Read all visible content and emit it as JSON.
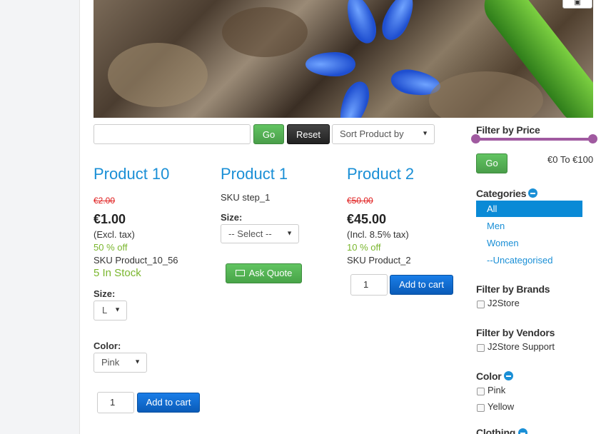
{
  "banner": {
    "corner_button_icon": "save-icon"
  },
  "search": {
    "go_label": "Go",
    "reset_label": "Reset",
    "sort_selected": "Sort Product by"
  },
  "products": [
    {
      "title": "Product 10",
      "old_price": "€2.00",
      "price": "€1.00",
      "tax_note": "(Excl. tax)",
      "discount": "50 % off",
      "sku": "SKU Product_10_56",
      "stock": "5 In Stock",
      "size_label": "Size:",
      "size_selected": "L",
      "color_label": "Color:",
      "color_selected": "Pink",
      "qty": "1",
      "cart_label": "Add to cart"
    },
    {
      "title": "Product 1",
      "sku": "SKU step_1",
      "size_label": "Size:",
      "size_selected": "-- Select --",
      "quote_label": "Ask Quote"
    },
    {
      "title": "Product 2",
      "old_price": "€50.00",
      "price": "€45.00",
      "tax_note": "(Incl. 8.5% tax)",
      "discount": "10 % off",
      "sku": "SKU Product_2",
      "qty": "1",
      "cart_label": "Add to cart"
    }
  ],
  "sidebar": {
    "price_filter": {
      "heading": "Filter by Price",
      "go_label": "Go",
      "range_text": "€0 To €100",
      "min": 0,
      "max": 100
    },
    "categories": {
      "heading": "Categories",
      "items": [
        "All",
        "Men",
        "Women",
        "--Uncategorised"
      ],
      "active": "All"
    },
    "brands": {
      "heading": "Filter by Brands",
      "items": [
        "J2Store"
      ]
    },
    "vendors": {
      "heading": "Filter by Vendors",
      "items": [
        "J2Store Support"
      ]
    },
    "color": {
      "heading": "Color",
      "items": [
        "Pink",
        "Yellow"
      ]
    },
    "clothing": {
      "heading": "Clothing"
    }
  },
  "colors": {
    "link_blue": "#1a8fd6",
    "accent_green": "#5cb85c",
    "cart_blue": "#0a6fd6",
    "price_red": "#e02020",
    "slider_purple": "#a05aa0"
  }
}
